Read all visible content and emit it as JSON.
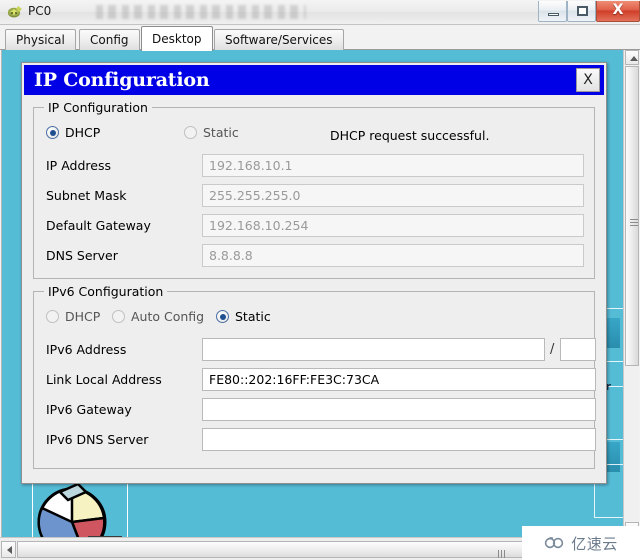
{
  "window": {
    "title": "PC0",
    "icon": "network-device-icon",
    "buttons": {
      "minimize": "minimize-icon",
      "maximize": "maximize-icon",
      "close": "X"
    }
  },
  "tabs": [
    {
      "label": "Physical",
      "active": false
    },
    {
      "label": "Config",
      "active": false
    },
    {
      "label": "Desktop",
      "active": true
    },
    {
      "label": "Software/Services",
      "active": false
    }
  ],
  "dialog": {
    "title": "IP Configuration",
    "close_label": "X",
    "ipv4": {
      "group_title": "IP Configuration",
      "modes": [
        {
          "label": "DHCP",
          "selected": true
        },
        {
          "label": "Static",
          "selected": false
        }
      ],
      "status": "DHCP request successful.",
      "fields": [
        {
          "label": "IP Address",
          "value": "192.168.10.1",
          "disabled": true
        },
        {
          "label": "Subnet Mask",
          "value": "255.255.255.0",
          "disabled": true
        },
        {
          "label": "Default Gateway",
          "value": "192.168.10.254",
          "disabled": true
        },
        {
          "label": "DNS Server",
          "value": "8.8.8.8",
          "disabled": true
        }
      ]
    },
    "ipv6": {
      "group_title": "IPv6 Configuration",
      "modes": [
        {
          "label": "DHCP",
          "selected": false
        },
        {
          "label": "Auto Config",
          "selected": false
        },
        {
          "label": "Static",
          "selected": true
        }
      ],
      "separator": "/",
      "fields": [
        {
          "label": "IPv6 Address",
          "value": "",
          "disabled": false
        },
        {
          "label": "Link Local Address",
          "value": "FE80::202:16FF:FE3C:73CA",
          "disabled": false
        },
        {
          "label": "IPv6 Gateway",
          "value": "",
          "disabled": false
        },
        {
          "label": "IPv6 DNS Server",
          "value": "",
          "disabled": false
        }
      ],
      "prefix_value": ""
    }
  },
  "desktop": {
    "background_color": "#55bcd6",
    "icon_name": "pie-chart-icon",
    "partial_label": "or"
  },
  "watermark": {
    "text": "亿速云",
    "logo": "cloud-logo-icon"
  }
}
